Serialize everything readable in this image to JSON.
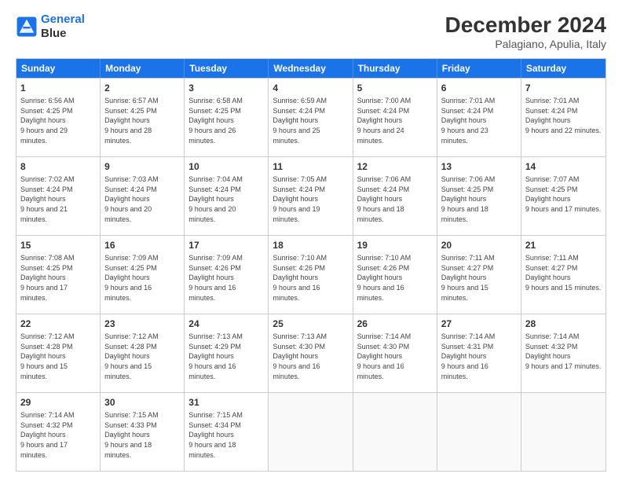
{
  "logo": {
    "line1": "General",
    "line2": "Blue"
  },
  "title": "December 2024",
  "subtitle": "Palagiano, Apulia, Italy",
  "days_of_week": [
    "Sunday",
    "Monday",
    "Tuesday",
    "Wednesday",
    "Thursday",
    "Friday",
    "Saturday"
  ],
  "weeks": [
    [
      {
        "day": "1",
        "sunrise": "6:56 AM",
        "sunset": "4:25 PM",
        "daylight": "9 hours and 29 minutes."
      },
      {
        "day": "2",
        "sunrise": "6:57 AM",
        "sunset": "4:25 PM",
        "daylight": "9 hours and 28 minutes."
      },
      {
        "day": "3",
        "sunrise": "6:58 AM",
        "sunset": "4:25 PM",
        "daylight": "9 hours and 26 minutes."
      },
      {
        "day": "4",
        "sunrise": "6:59 AM",
        "sunset": "4:24 PM",
        "daylight": "9 hours and 25 minutes."
      },
      {
        "day": "5",
        "sunrise": "7:00 AM",
        "sunset": "4:24 PM",
        "daylight": "9 hours and 24 minutes."
      },
      {
        "day": "6",
        "sunrise": "7:01 AM",
        "sunset": "4:24 PM",
        "daylight": "9 hours and 23 minutes."
      },
      {
        "day": "7",
        "sunrise": "7:01 AM",
        "sunset": "4:24 PM",
        "daylight": "9 hours and 22 minutes."
      }
    ],
    [
      {
        "day": "8",
        "sunrise": "7:02 AM",
        "sunset": "4:24 PM",
        "daylight": "9 hours and 21 minutes."
      },
      {
        "day": "9",
        "sunrise": "7:03 AM",
        "sunset": "4:24 PM",
        "daylight": "9 hours and 20 minutes."
      },
      {
        "day": "10",
        "sunrise": "7:04 AM",
        "sunset": "4:24 PM",
        "daylight": "9 hours and 20 minutes."
      },
      {
        "day": "11",
        "sunrise": "7:05 AM",
        "sunset": "4:24 PM",
        "daylight": "9 hours and 19 minutes."
      },
      {
        "day": "12",
        "sunrise": "7:06 AM",
        "sunset": "4:24 PM",
        "daylight": "9 hours and 18 minutes."
      },
      {
        "day": "13",
        "sunrise": "7:06 AM",
        "sunset": "4:25 PM",
        "daylight": "9 hours and 18 minutes."
      },
      {
        "day": "14",
        "sunrise": "7:07 AM",
        "sunset": "4:25 PM",
        "daylight": "9 hours and 17 minutes."
      }
    ],
    [
      {
        "day": "15",
        "sunrise": "7:08 AM",
        "sunset": "4:25 PM",
        "daylight": "9 hours and 17 minutes."
      },
      {
        "day": "16",
        "sunrise": "7:09 AM",
        "sunset": "4:25 PM",
        "daylight": "9 hours and 16 minutes."
      },
      {
        "day": "17",
        "sunrise": "7:09 AM",
        "sunset": "4:26 PM",
        "daylight": "9 hours and 16 minutes."
      },
      {
        "day": "18",
        "sunrise": "7:10 AM",
        "sunset": "4:26 PM",
        "daylight": "9 hours and 16 minutes."
      },
      {
        "day": "19",
        "sunrise": "7:10 AM",
        "sunset": "4:26 PM",
        "daylight": "9 hours and 16 minutes."
      },
      {
        "day": "20",
        "sunrise": "7:11 AM",
        "sunset": "4:27 PM",
        "daylight": "9 hours and 15 minutes."
      },
      {
        "day": "21",
        "sunrise": "7:11 AM",
        "sunset": "4:27 PM",
        "daylight": "9 hours and 15 minutes."
      }
    ],
    [
      {
        "day": "22",
        "sunrise": "7:12 AM",
        "sunset": "4:28 PM",
        "daylight": "9 hours and 15 minutes."
      },
      {
        "day": "23",
        "sunrise": "7:12 AM",
        "sunset": "4:28 PM",
        "daylight": "9 hours and 15 minutes."
      },
      {
        "day": "24",
        "sunrise": "7:13 AM",
        "sunset": "4:29 PM",
        "daylight": "9 hours and 16 minutes."
      },
      {
        "day": "25",
        "sunrise": "7:13 AM",
        "sunset": "4:30 PM",
        "daylight": "9 hours and 16 minutes."
      },
      {
        "day": "26",
        "sunrise": "7:14 AM",
        "sunset": "4:30 PM",
        "daylight": "9 hours and 16 minutes."
      },
      {
        "day": "27",
        "sunrise": "7:14 AM",
        "sunset": "4:31 PM",
        "daylight": "9 hours and 16 minutes."
      },
      {
        "day": "28",
        "sunrise": "7:14 AM",
        "sunset": "4:32 PM",
        "daylight": "9 hours and 17 minutes."
      }
    ],
    [
      {
        "day": "29",
        "sunrise": "7:14 AM",
        "sunset": "4:32 PM",
        "daylight": "9 hours and 17 minutes."
      },
      {
        "day": "30",
        "sunrise": "7:15 AM",
        "sunset": "4:33 PM",
        "daylight": "9 hours and 18 minutes."
      },
      {
        "day": "31",
        "sunrise": "7:15 AM",
        "sunset": "4:34 PM",
        "daylight": "9 hours and 18 minutes."
      },
      null,
      null,
      null,
      null
    ]
  ]
}
